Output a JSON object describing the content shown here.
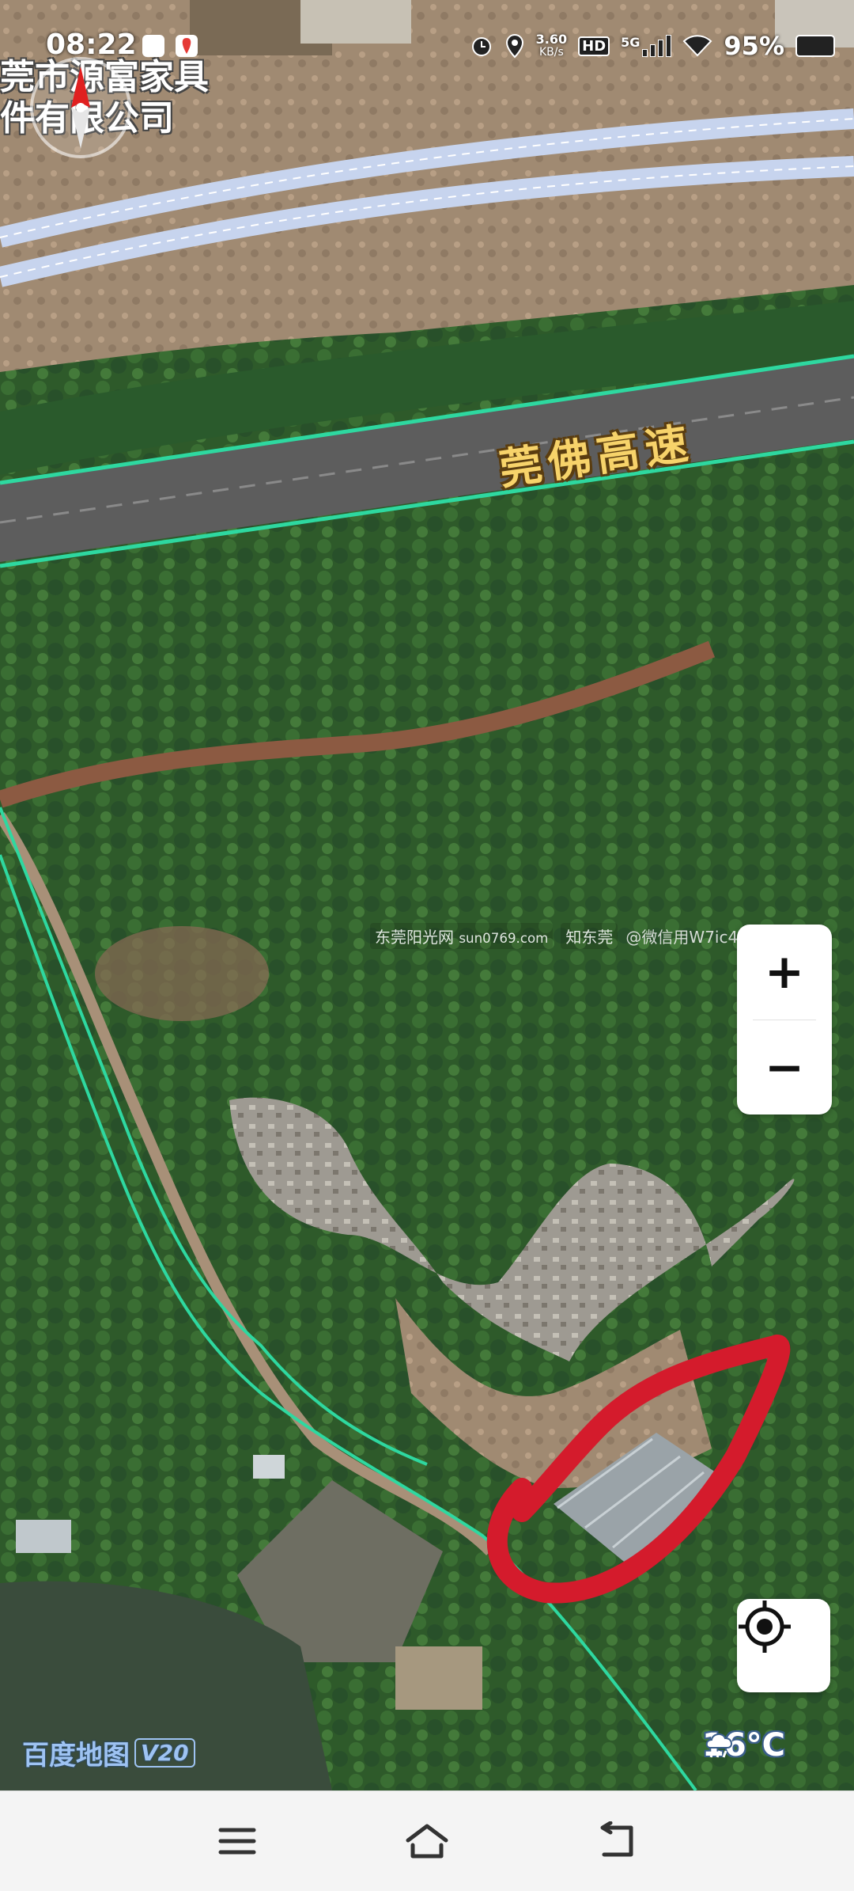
{
  "status_bar": {
    "time": "08:22",
    "net_speed_value": "3.60",
    "net_speed_unit": "KB/s",
    "hd_label": "HD",
    "network_label": "5G",
    "battery_percent": "95%",
    "icons": [
      "baidu-paw-icon",
      "location-pin-app-icon",
      "alarm-icon",
      "location-icon",
      "hd-icon",
      "signal-5g-icon",
      "wifi-icon",
      "battery-icon"
    ]
  },
  "map": {
    "poi_label": "莞市源富家具\n件有限公司",
    "road_label": "莞佛高速",
    "watermark": {
      "brand1": "东莞阳光网",
      "brand1_sub": "sun0769.com",
      "brand2": "知东莞",
      "credit": "@微信用W7ic4"
    },
    "annotation": "red-hand-drawn-circle",
    "route_color": "#2ed8a0",
    "highlight_color": "#d41b2c"
  },
  "controls": {
    "zoom_in": "+",
    "zoom_out": "−",
    "locate_icon": "crosshair-locate-icon"
  },
  "footer": {
    "logo_text": "百度地图",
    "logo_version": "V20",
    "weather_icon": "rain-cloud-icon",
    "temperature": "16°C"
  },
  "nav_bar": {
    "icons": [
      "menu-icon",
      "home-icon",
      "back-icon"
    ]
  }
}
